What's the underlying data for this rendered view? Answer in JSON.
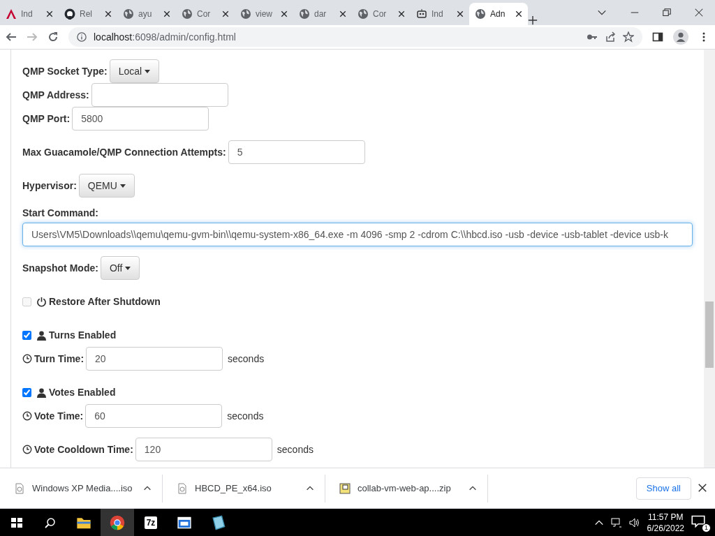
{
  "tabs": [
    {
      "label": "Ind",
      "kind": "a-logo",
      "selected": false
    },
    {
      "label": "Rel",
      "kind": "cat",
      "selected": false
    },
    {
      "label": "ayu",
      "kind": "globe",
      "selected": false
    },
    {
      "label": "Cor",
      "kind": "globe",
      "selected": false
    },
    {
      "label": "view",
      "kind": "globe",
      "selected": false
    },
    {
      "label": "dar",
      "kind": "globe",
      "selected": false
    },
    {
      "label": "Cor",
      "kind": "globe",
      "selected": false
    },
    {
      "label": "Ind",
      "kind": "robot",
      "selected": false
    },
    {
      "label": "Adn",
      "kind": "globe",
      "selected": true
    }
  ],
  "address_bar": {
    "host": "localhost",
    "path": ":6098/admin/config.html"
  },
  "form": [
    [
      {
        "kind": "dropdown",
        "label": "QMP Socket Type:",
        "value": "Local"
      },
      {
        "kind": "input",
        "label": "QMP Address:"
      },
      {
        "kind": "input",
        "label": "QMP Port:",
        "value": "5800"
      }
    ],
    [
      {
        "kind": "input",
        "label": "Max Guacamole/QMP Connection Attempts:",
        "value": "5"
      }
    ],
    [
      {
        "kind": "dropdown",
        "label": "Hypervisor:",
        "value": "QEMU"
      }
    ],
    [
      {
        "kind": "wide-input",
        "label": "Start Command:",
        "value": "Users\\VM5\\Downloads\\\\qemu\\qemu-gvm-bin\\\\qemu-system-x86_64.exe -m 4096 -smp 2 -cdrom C:\\\\hbcd.iso -usb  -device -usb-tablet -device usb-k"
      }
    ],
    [
      {
        "kind": "dropdown",
        "label": "Snapshot Mode:",
        "value": "Off"
      }
    ],
    [
      {
        "kind": "power-checkbox",
        "label": "Restore After Shutdown",
        "checked": false,
        "disabled": true
      }
    ],
    [
      {
        "kind": "user-checkbox",
        "label": "Turns Enabled",
        "checked": true,
        "disabled": false
      },
      {
        "kind": "timed-input",
        "label": "Turn Time:",
        "value": "20",
        "suffix": "seconds"
      }
    ],
    [
      {
        "kind": "user-checkbox",
        "label": "Votes Enabled",
        "checked": true,
        "disabled": false
      },
      {
        "kind": "timed-input",
        "label": "Vote Time:",
        "value": "60",
        "suffix": "seconds"
      }
    ],
    [
      {
        "kind": "timed-input",
        "label": "Vote Cooldown Time:",
        "value": "120",
        "suffix": "seconds"
      }
    ]
  ],
  "downloads": [
    {
      "name": "Windows XP Media....iso",
      "kind": "disc"
    },
    {
      "name": "HBCD_PE_x64.iso",
      "kind": "disc"
    },
    {
      "name": "collab-vm-web-ap....zip",
      "kind": "archive"
    }
  ],
  "show_all": "Show all",
  "taskbar": {
    "seven_zip": "7z",
    "time": "11:57 PM",
    "date": "6/26/2022",
    "notifications": "1"
  }
}
